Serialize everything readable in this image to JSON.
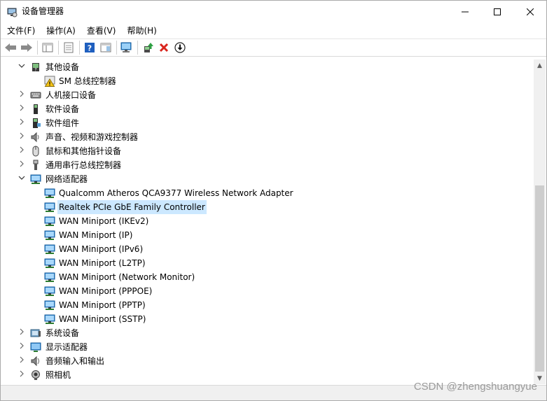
{
  "window": {
    "title": "设备管理器",
    "controls": {
      "minimize": "–",
      "maximize": "☐",
      "close": "✕"
    }
  },
  "menubar": {
    "items": [
      {
        "label": "文件(F)"
      },
      {
        "label": "操作(A)"
      },
      {
        "label": "查看(V)"
      },
      {
        "label": "帮助(H)"
      }
    ]
  },
  "toolbar": {
    "buttons": [
      {
        "icon": "back-arrow-icon"
      },
      {
        "icon": "forward-arrow-icon"
      },
      {
        "icon": "show-hide-console-tree-icon"
      },
      {
        "icon": "properties-icon"
      },
      {
        "icon": "help-icon"
      },
      {
        "icon": "action-pane-icon"
      },
      {
        "icon": "scan-hardware-changes-icon"
      },
      {
        "icon": "update-driver-icon"
      },
      {
        "icon": "uninstall-device-icon"
      },
      {
        "icon": "enable-device-icon"
      }
    ]
  },
  "tree": {
    "rows": [
      {
        "label": "其他设备",
        "expanded": true,
        "level": 0,
        "icon": "unknown-device-icon"
      },
      {
        "label": "SM 总线控制器",
        "level": 1,
        "icon": "warning-device-icon"
      },
      {
        "label": "人机接口设备",
        "expanded": false,
        "level": 0,
        "icon": "hid-icon"
      },
      {
        "label": "软件设备",
        "expanded": false,
        "level": 0,
        "icon": "software-device-icon"
      },
      {
        "label": "软件组件",
        "expanded": false,
        "level": 0,
        "icon": "software-component-icon"
      },
      {
        "label": "声音、视频和游戏控制器",
        "expanded": false,
        "level": 0,
        "icon": "speaker-icon"
      },
      {
        "label": "鼠标和其他指针设备",
        "expanded": false,
        "level": 0,
        "icon": "mouse-icon"
      },
      {
        "label": "通用串行总线控制器",
        "expanded": false,
        "level": 0,
        "icon": "usb-icon"
      },
      {
        "label": "网络适配器",
        "expanded": true,
        "level": 0,
        "icon": "network-adapter-icon"
      },
      {
        "label": "Qualcomm Atheros QCA9377 Wireless Network Adapter",
        "level": 1,
        "icon": "network-adapter-icon"
      },
      {
        "label": "Realtek PCIe GbE Family Controller",
        "level": 1,
        "icon": "network-adapter-icon",
        "selected": true
      },
      {
        "label": "WAN Miniport (IKEv2)",
        "level": 1,
        "icon": "network-adapter-icon"
      },
      {
        "label": "WAN Miniport (IP)",
        "level": 1,
        "icon": "network-adapter-icon"
      },
      {
        "label": "WAN Miniport (IPv6)",
        "level": 1,
        "icon": "network-adapter-icon"
      },
      {
        "label": "WAN Miniport (L2TP)",
        "level": 1,
        "icon": "network-adapter-icon"
      },
      {
        "label": "WAN Miniport (Network Monitor)",
        "level": 1,
        "icon": "network-adapter-icon"
      },
      {
        "label": "WAN Miniport (PPPOE)",
        "level": 1,
        "icon": "network-adapter-icon"
      },
      {
        "label": "WAN Miniport (PPTP)",
        "level": 1,
        "icon": "network-adapter-icon"
      },
      {
        "label": "WAN Miniport (SSTP)",
        "level": 1,
        "icon": "network-adapter-icon"
      },
      {
        "label": "系统设备",
        "expanded": false,
        "level": 0,
        "icon": "system-device-icon"
      },
      {
        "label": "显示适配器",
        "expanded": false,
        "level": 0,
        "icon": "display-adapter-icon"
      },
      {
        "label": "音频输入和输出",
        "expanded": false,
        "level": 0,
        "icon": "audio-io-icon"
      },
      {
        "label": "照相机",
        "expanded": false,
        "level": 0,
        "icon": "camera-icon"
      }
    ]
  },
  "scrollbar": {
    "up": "▲",
    "down": "▼"
  },
  "watermark": "CSDN @zhengshuangyue",
  "colors": {
    "selection": "#cce8ff",
    "network_icon": "#2b88d8",
    "uninstall_red": "#d9251d",
    "help_blue": "#1f5fbf"
  }
}
